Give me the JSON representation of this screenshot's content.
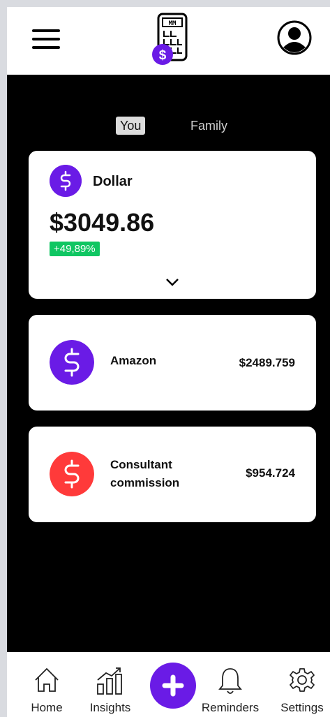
{
  "toggle": {
    "you": "You",
    "family": "Family"
  },
  "balance_card": {
    "currency_label": "Dollar",
    "amount": "$3049.86",
    "change": "+49,89%"
  },
  "transactions": [
    {
      "name": "Amazon",
      "amount": "$2489.759",
      "color": "#6a1be6"
    },
    {
      "name": "Consultant commission",
      "amount": "$954.724",
      "color": "#ff3a3a"
    }
  ],
  "nav": {
    "home": "Home",
    "insights": "Insights",
    "reminders": "Reminders",
    "settings": "Settings"
  },
  "colors": {
    "accent": "#6a1be6",
    "positive": "#0fc662",
    "negative": "#ff3a3a"
  }
}
